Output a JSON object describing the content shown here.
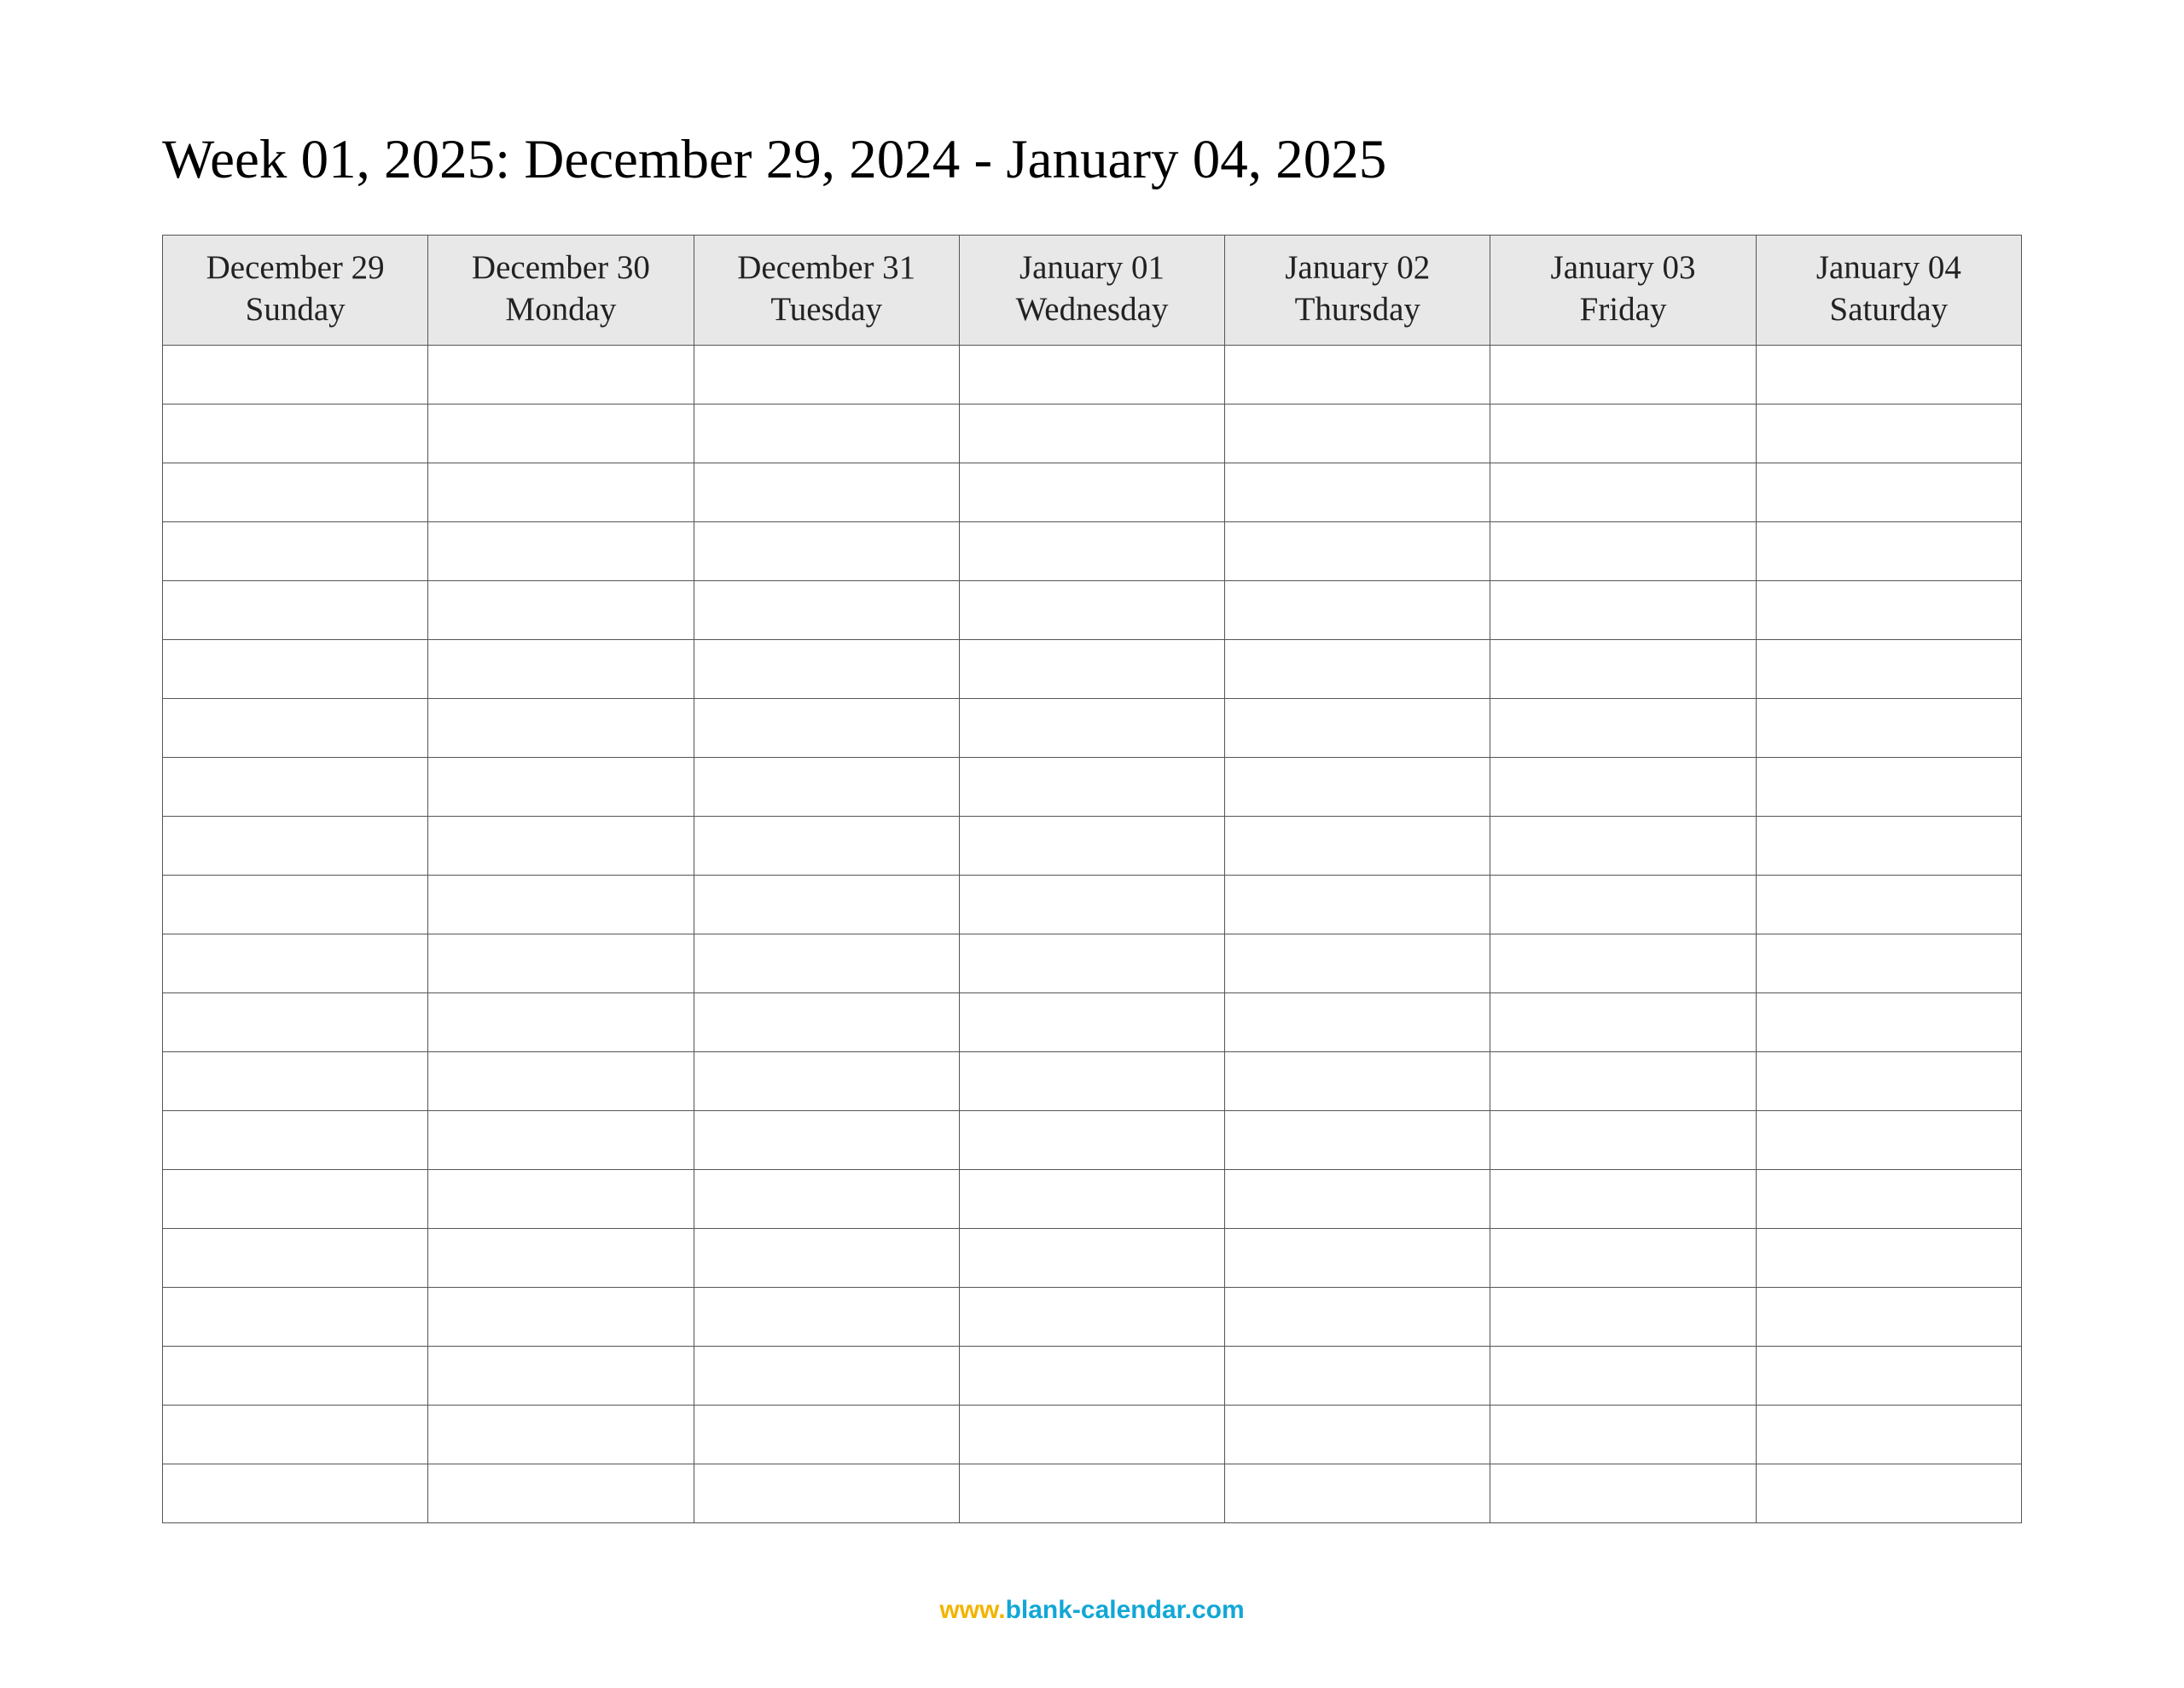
{
  "title": "Week 01, 2025: December 29, 2024 - January 04, 2025",
  "columns": [
    {
      "date": "December 29",
      "day": "Sunday"
    },
    {
      "date": "December 30",
      "day": "Monday"
    },
    {
      "date": "December 31",
      "day": "Tuesday"
    },
    {
      "date": "January 01",
      "day": "Wednesday"
    },
    {
      "date": "January 02",
      "day": "Thursday"
    },
    {
      "date": "January 03",
      "day": "Friday"
    },
    {
      "date": "January 04",
      "day": "Saturday"
    }
  ],
  "body_rows": 20,
  "footer": {
    "www": "www.",
    "domain": "blank-calendar.com"
  }
}
